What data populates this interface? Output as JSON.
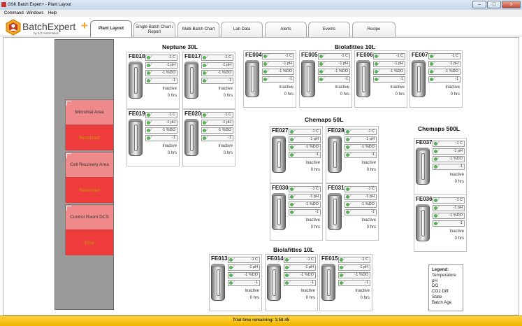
{
  "window": {
    "title": "GSK Batch Expert+ - Plant Layout",
    "minimize": "–",
    "maximize": "□",
    "close": "x"
  },
  "menu": [
    "Command",
    "Windows",
    "Help"
  ],
  "logo": {
    "name": "BatchExpert",
    "plus": "+",
    "sub": "by ILS Automation"
  },
  "tabs": [
    {
      "label": "Plant Layout"
    },
    {
      "label": "Single-Batch Chart / Report"
    },
    {
      "label": "Multi-Batch Chart"
    },
    {
      "label": "Lab Data"
    },
    {
      "label": "Alerts"
    },
    {
      "label": "Events"
    },
    {
      "label": "Recipe"
    }
  ],
  "areas": [
    {
      "name": "Microbial Area",
      "status": "Restricted"
    },
    {
      "name": "Cell Recovery Area",
      "status": "Restricted"
    },
    {
      "name": "Control Room DCS",
      "status": "Error"
    }
  ],
  "groups": [
    {
      "name": "Neptune 30L"
    },
    {
      "name": "Biolafittes 10L"
    },
    {
      "name": "Chemaps 50L"
    },
    {
      "name": "Chemaps 500L"
    },
    {
      "name": "Biolafittes 10L"
    }
  ],
  "readout_values": [
    "-1 C",
    "-1 pH",
    "-1 %DO",
    "-1"
  ],
  "units": [
    {
      "name": "FE018",
      "state": "Inactive",
      "age": "0 hrs"
    },
    {
      "name": "FE017",
      "state": "Inactive",
      "age": "0 hrs"
    },
    {
      "name": "FE019",
      "state": "Inactive",
      "age": "0 hrs"
    },
    {
      "name": "FE020",
      "state": "Inactive",
      "age": "0 hrs"
    },
    {
      "name": "FE004",
      "state": "Inactive",
      "age": "0 hrs"
    },
    {
      "name": "FE005",
      "state": "Inactive",
      "age": "0 hrs"
    },
    {
      "name": "FE006",
      "state": "Inactive",
      "age": "0 hrs"
    },
    {
      "name": "FE007",
      "state": "Inactive",
      "age": "0 hrs"
    },
    {
      "name": "FE027",
      "state": "Inactive",
      "age": "0 hrs"
    },
    {
      "name": "FE028",
      "state": "Inactive",
      "age": "0 hrs"
    },
    {
      "name": "FE030",
      "state": "Inactive",
      "age": "0 hrs"
    },
    {
      "name": "FE031",
      "state": "Inactive",
      "age": "0 hrs"
    },
    {
      "name": "FE037",
      "state": "Inactive",
      "age": "0 hrs"
    },
    {
      "name": "FE036",
      "state": "Inactive",
      "age": "0 hrs"
    },
    {
      "name": "FE013",
      "state": "Inactive",
      "age": "0 hrs"
    },
    {
      "name": "FE014",
      "state": "Inactive",
      "age": "0 hrs"
    },
    {
      "name": "FE015",
      "state": "Inactive",
      "age": "0 hrs"
    }
  ],
  "legend": {
    "title": "Legend:",
    "items": [
      "Temperature",
      "pH",
      "DO",
      "CO2 Diff",
      "State",
      "Batch Age"
    ]
  },
  "status": "Trial time remaining: 1:58:45",
  "colors": {
    "area_top": "#f08a8a",
    "area_bottom": "#ee3b3b",
    "status_bar": "#ffd23a",
    "indicator": "#54b254"
  }
}
